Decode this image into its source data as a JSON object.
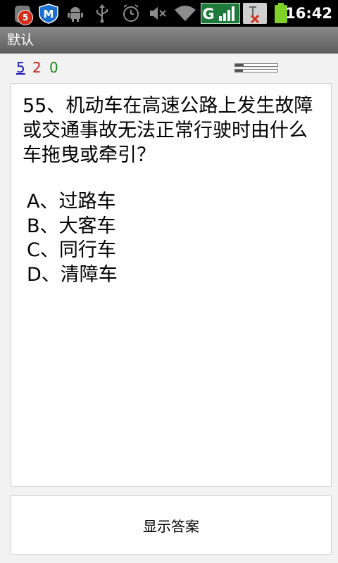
{
  "status_bar": {
    "notification_count": "5",
    "icons": [
      "app-icon",
      "shield-m-icon",
      "android-debug-icon",
      "usb-icon",
      "alarm-icon",
      "mute-icon",
      "wifi-icon",
      "3g-signal-icon",
      "sim-error-icon",
      "battery-icon"
    ],
    "network_letter": "G",
    "time": "16:42"
  },
  "title_bar": {
    "title": "默认"
  },
  "counter": {
    "total": "5",
    "wrong": "2",
    "right": "0",
    "progress_1": 0.2,
    "progress_2": 0.18
  },
  "question": {
    "text": "55、机动车在高速公路上发生故障或交通事故无法正常行驶时由什么车拖曳或牵引？",
    "options": [
      "A、过路车",
      "B、大客车",
      "C、同行车",
      "D、清障车"
    ]
  },
  "actions": {
    "show_answer_label": "显示答案"
  },
  "colors": {
    "total_count": "#1a1ab8",
    "wrong_count": "#c8201c",
    "right_count": "#1c8a1c",
    "notification_badge": "#d62c1a",
    "network_bg": "#1e7a3a"
  }
}
